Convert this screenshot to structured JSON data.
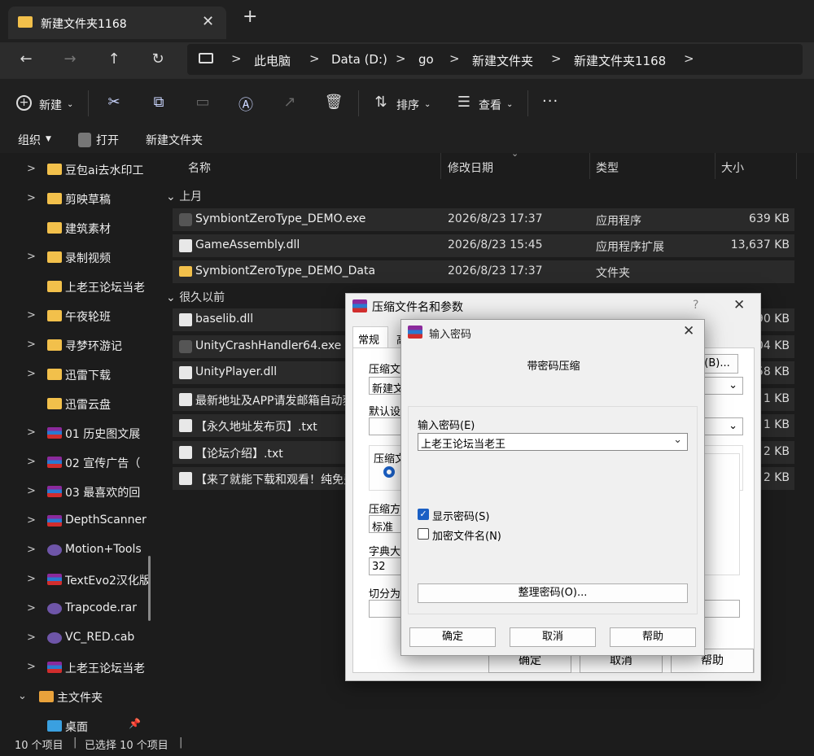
{
  "tab": {
    "title": "新建文件夹1168",
    "add": "+",
    "close": "✕"
  },
  "nav": {
    "back": "←",
    "forward": "→",
    "up": "↑",
    "refresh": "↻",
    "breadcrumb": [
      "此电脑",
      "Data (D:)",
      "go",
      "新建文件夹",
      "新建文件夹1168"
    ]
  },
  "toolbar": {
    "new": "新建",
    "sort": "排序",
    "view": "查看",
    "more": "···"
  },
  "cmdbar": {
    "organize": "组织",
    "open": "打开",
    "newfolder": "新建文件夹"
  },
  "sidebar": {
    "items": [
      {
        "label": "豆包ai去水印工",
        "icon": "folder",
        "expand": true
      },
      {
        "label": "剪映草稿",
        "icon": "folder",
        "expand": true
      },
      {
        "label": "建筑素材",
        "icon": "folder",
        "expand": false
      },
      {
        "label": "录制视频",
        "icon": "folder",
        "expand": true
      },
      {
        "label": "上老王论坛当老",
        "icon": "folder",
        "expand": false
      },
      {
        "label": "午夜轮班",
        "icon": "folder",
        "expand": true
      },
      {
        "label": "寻梦环游记",
        "icon": "folder",
        "expand": true
      },
      {
        "label": "迅雷下载",
        "icon": "folder",
        "expand": true
      },
      {
        "label": "迅雷云盘",
        "icon": "folder",
        "expand": false
      },
      {
        "label": "01 历史图文展",
        "icon": "rar",
        "expand": true
      },
      {
        "label": "02 宣传广告（",
        "icon": "rar",
        "expand": true
      },
      {
        "label": "03 最喜欢的回",
        "icon": "rar",
        "expand": true
      },
      {
        "label": "DepthScanner",
        "icon": "rar",
        "expand": true
      },
      {
        "label": "Motion+Tools",
        "icon": "rar-circle",
        "expand": true
      },
      {
        "label": "TextEvo2汉化版",
        "icon": "rar",
        "expand": true
      },
      {
        "label": "Trapcode.rar",
        "icon": "rar-circle",
        "expand": true
      },
      {
        "label": "VC_RED.cab",
        "icon": "cab",
        "expand": true
      },
      {
        "label": "上老王论坛当老",
        "icon": "rar",
        "expand": true
      }
    ],
    "home": "主文件夹",
    "desktop": "桌面"
  },
  "columns": {
    "name": "名称",
    "date": "修改日期",
    "type": "类型",
    "size": "大小"
  },
  "groups": {
    "recent": "上月",
    "old": "很久以前"
  },
  "files": [
    {
      "name": "SymbiontZeroType_DEMO.exe",
      "date": "2026/8/23 17:37",
      "type": "应用程序",
      "size": "639 KB",
      "icon": "exe"
    },
    {
      "name": "GameAssembly.dll",
      "date": "2026/8/23 15:45",
      "type": "应用程序扩展",
      "size": "13,637 KB",
      "icon": "dll"
    },
    {
      "name": "SymbiontZeroType_DEMO_Data",
      "date": "2026/8/23 17:37",
      "type": "文件夹",
      "size": "",
      "icon": "folder"
    }
  ],
  "files_old": [
    {
      "name": "baselib.dll",
      "size": "90 KB",
      "icon": "dll"
    },
    {
      "name": "UnityCrashHandler64.exe",
      "size": "04 KB",
      "icon": "exe"
    },
    {
      "name": "UnityPlayer.dll",
      "size": "58 KB",
      "icon": "dll"
    },
    {
      "name": "最新地址及APP请发邮箱自动获",
      "size": "1 KB",
      "icon": "txt"
    },
    {
      "name": "【永久地址发布页】.txt",
      "size": "1 KB",
      "icon": "txt"
    },
    {
      "name": "【论坛介绍】.txt",
      "size": "2 KB",
      "icon": "txt"
    },
    {
      "name": "【来了就能下载和观看！纯免费",
      "size": "2 KB",
      "icon": "txt"
    }
  ],
  "status": {
    "count": "10 个项目",
    "selected": "已选择 10 个项目"
  },
  "dialog1": {
    "title": "压缩文件名和参数",
    "help": "?",
    "close": "✕",
    "tab_general": "常规",
    "tab_adv": "高",
    "archive_label": "压缩文",
    "archive_value": "新建文",
    "browse": "(B)...",
    "default_label": "默认设",
    "format_label": "压缩文",
    "method_label": "压缩方",
    "method_value": "标准",
    "dict_label": "字典大",
    "dict_value": "32",
    "split_label": "切分为",
    "ok": "确定",
    "cancel": "取消",
    "helpbtn": "帮助"
  },
  "dialog2": {
    "title": "输入密码",
    "close": "✕",
    "header": "带密码压缩",
    "pwd_label": "输入密码(E)",
    "pwd_value": "上老王论坛当老王",
    "show_pwd": "显示密码(S)",
    "encrypt_names": "加密文件名(N)",
    "organize": "整理密码(O)...",
    "ok": "确定",
    "cancel": "取消",
    "help": "帮助"
  }
}
